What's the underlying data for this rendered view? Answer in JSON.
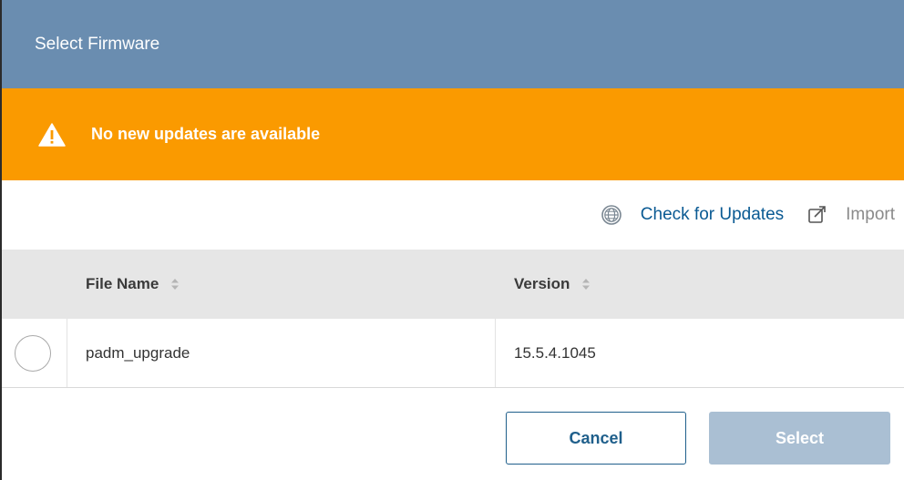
{
  "dialog": {
    "title": "Select Firmware"
  },
  "alert": {
    "message": "No new updates are available",
    "icon": "warning-triangle-icon",
    "color": "#fa9a00"
  },
  "toolbar": {
    "check_updates_label": "Check for Updates",
    "check_updates_icon": "globe-icon",
    "import_label": "Import",
    "import_icon": "import-icon"
  },
  "table": {
    "columns": [
      {
        "label": "File Name",
        "sortable": true
      },
      {
        "label": "Version",
        "sortable": true
      }
    ],
    "rows": [
      {
        "selected": false,
        "file_name": "padm_upgrade",
        "version": "15.5.4.1045"
      }
    ]
  },
  "footer": {
    "cancel_label": "Cancel",
    "select_label": "Select"
  },
  "colors": {
    "header_bg": "#6a8db0",
    "link": "#0a5a93",
    "select_disabled": "#aabfd3"
  }
}
